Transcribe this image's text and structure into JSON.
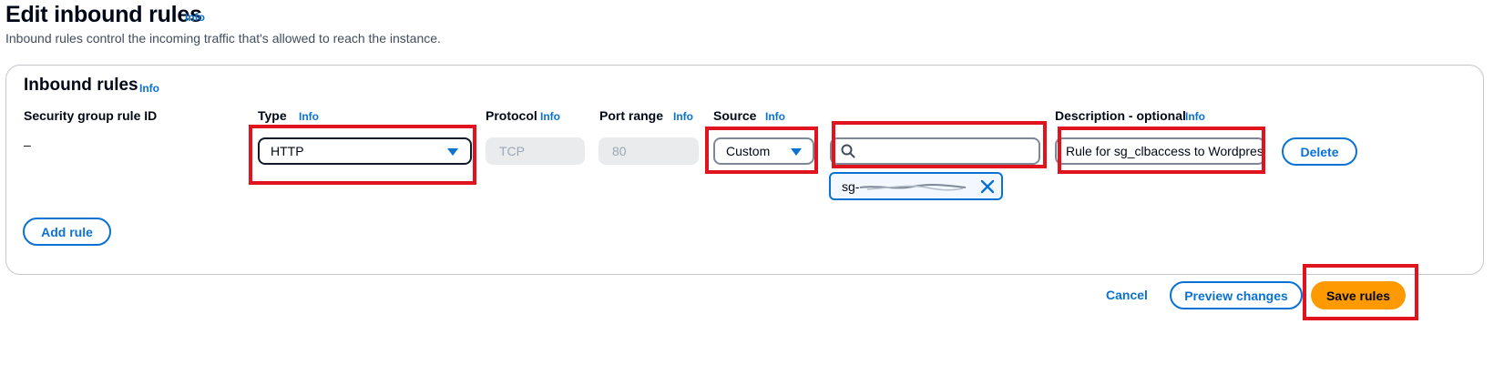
{
  "page": {
    "title": "Edit inbound rules",
    "title_info": "Info",
    "subtitle": "Inbound rules control the incoming traffic that's allowed to reach the instance."
  },
  "panel": {
    "title": "Inbound rules",
    "title_info": "Info",
    "columns": {
      "rule_id": "Security group rule ID",
      "type": "Type",
      "type_info": "Info",
      "protocol": "Protocol",
      "protocol_info": "Info",
      "port_range": "Port range",
      "port_range_info": "Info",
      "source": "Source",
      "source_info": "Info",
      "description": "Description - optional",
      "description_info": "Info"
    },
    "rule": {
      "rule_id": "–",
      "type": "HTTP",
      "protocol": "TCP",
      "port_range": "80",
      "source": "Custom",
      "source_search_value": "",
      "source_token": "sg-",
      "description": "Rule for sg_clbaccess to Wordpress",
      "delete_label": "Delete"
    },
    "add_rule_label": "Add rule"
  },
  "footer": {
    "cancel_label": "Cancel",
    "preview_label": "Preview changes",
    "save_label": "Save rules"
  },
  "colors": {
    "accent": "#0972d3",
    "primary_button": "#ff9900",
    "highlight_box": "#e0131f"
  },
  "icons": [
    "caret-down-icon",
    "search-icon",
    "close-icon"
  ]
}
